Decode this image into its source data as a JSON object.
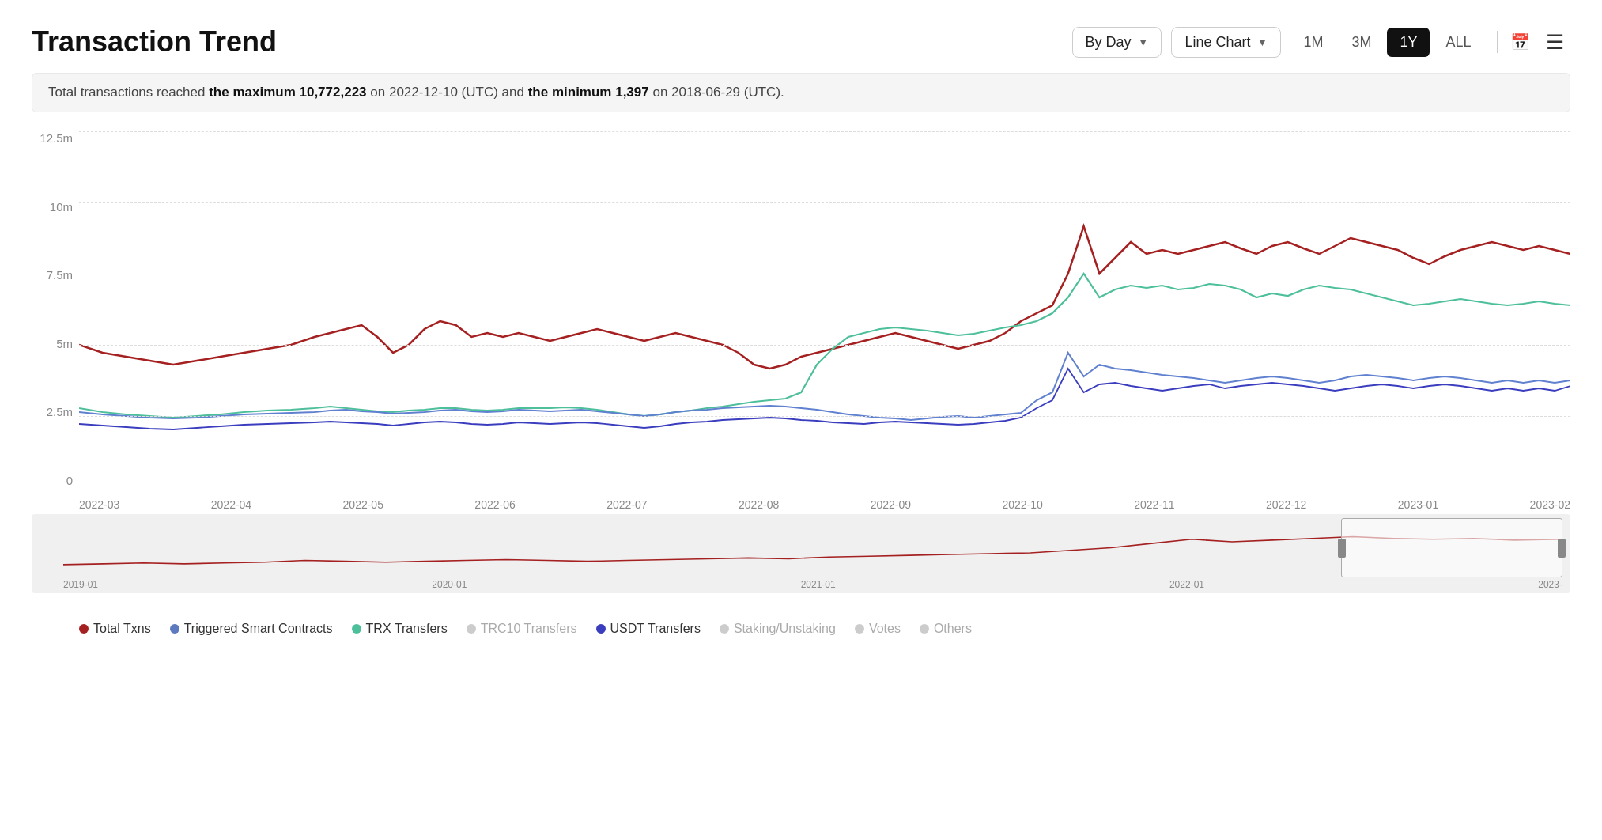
{
  "header": {
    "title": "Transaction Trend",
    "dropdown_day": "By Day",
    "dropdown_chart": "Line Chart",
    "time_buttons": [
      "1M",
      "3M",
      "1Y",
      "ALL"
    ],
    "active_time": "1Y"
  },
  "info_bar": {
    "text_before": "Total transactions reached ",
    "max_label": "the maximum 10,772,223",
    "text_mid": " on 2022-12-10 (UTC) and ",
    "min_label": "the minimum 1,397",
    "text_after": " on 2018-06-29 (UTC)."
  },
  "y_axis": {
    "labels": [
      "12.5m",
      "10m",
      "7.5m",
      "5m",
      "2.5m",
      "0"
    ]
  },
  "x_axis": {
    "labels": [
      "2022-03",
      "2022-04",
      "2022-05",
      "2022-06",
      "2022-07",
      "2022-08",
      "2022-09",
      "2022-10",
      "2022-11",
      "2022-12",
      "2023-01",
      "2023-02"
    ]
  },
  "mini_chart": {
    "x_labels": [
      "2019-01",
      "2020-01",
      "2021-01",
      "2022-01",
      "2023-"
    ]
  },
  "legend": {
    "items": [
      {
        "label": "Total Txns",
        "color": "#a52020",
        "active": true
      },
      {
        "label": "Triggered Smart Contracts",
        "color": "#5b7abf",
        "active": true
      },
      {
        "label": "TRX Transfers",
        "color": "#4dbf9b",
        "active": true
      },
      {
        "label": "TRC10 Transfers",
        "color": "#ccc",
        "active": false
      },
      {
        "label": "USDT Transfers",
        "color": "#3b3dbf",
        "active": true
      },
      {
        "label": "Staking/Unstaking",
        "color": "#ccc",
        "active": false
      },
      {
        "label": "Votes",
        "color": "#ccc",
        "active": false
      },
      {
        "label": "Others",
        "color": "#ccc",
        "active": false
      }
    ]
  }
}
